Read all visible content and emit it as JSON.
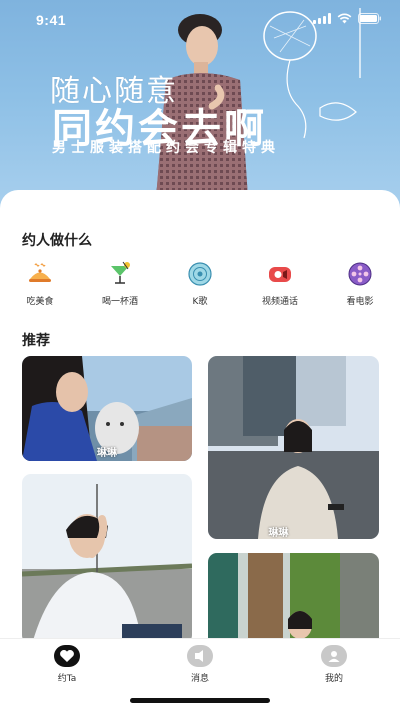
{
  "status_bar": {
    "time": "9:41"
  },
  "hero": {
    "line1": "随心随意",
    "line2": "同约会去啊",
    "subtitle": "男士服装搭配约会专辑特典"
  },
  "section_activities": {
    "title": "约人做什么",
    "items": [
      {
        "label": "吃美食",
        "icon": "dish-cloche-icon"
      },
      {
        "label": "喝一杯酒",
        "icon": "cocktail-icon"
      },
      {
        "label": "K歌",
        "icon": "vinyl-disc-icon"
      },
      {
        "label": "视频通话",
        "icon": "video-camera-icon"
      },
      {
        "label": "看电影",
        "icon": "film-reel-icon"
      }
    ]
  },
  "section_recommend": {
    "title": "推荐",
    "cards": [
      {
        "name": "琳琳"
      },
      {
        "name": "琳琳"
      },
      {
        "name": ""
      },
      {
        "name": ""
      }
    ]
  },
  "tabbar": {
    "items": [
      {
        "label": "约Ta",
        "icon": "heart-icon",
        "active": true
      },
      {
        "label": "消息",
        "icon": "message-icon",
        "active": false
      },
      {
        "label": "我的",
        "icon": "profile-icon",
        "active": false
      }
    ]
  },
  "colors": {
    "hero_blue": "#8ec0e6",
    "active_tab": "#111111",
    "inactive_tab": "#c8c8c8"
  }
}
